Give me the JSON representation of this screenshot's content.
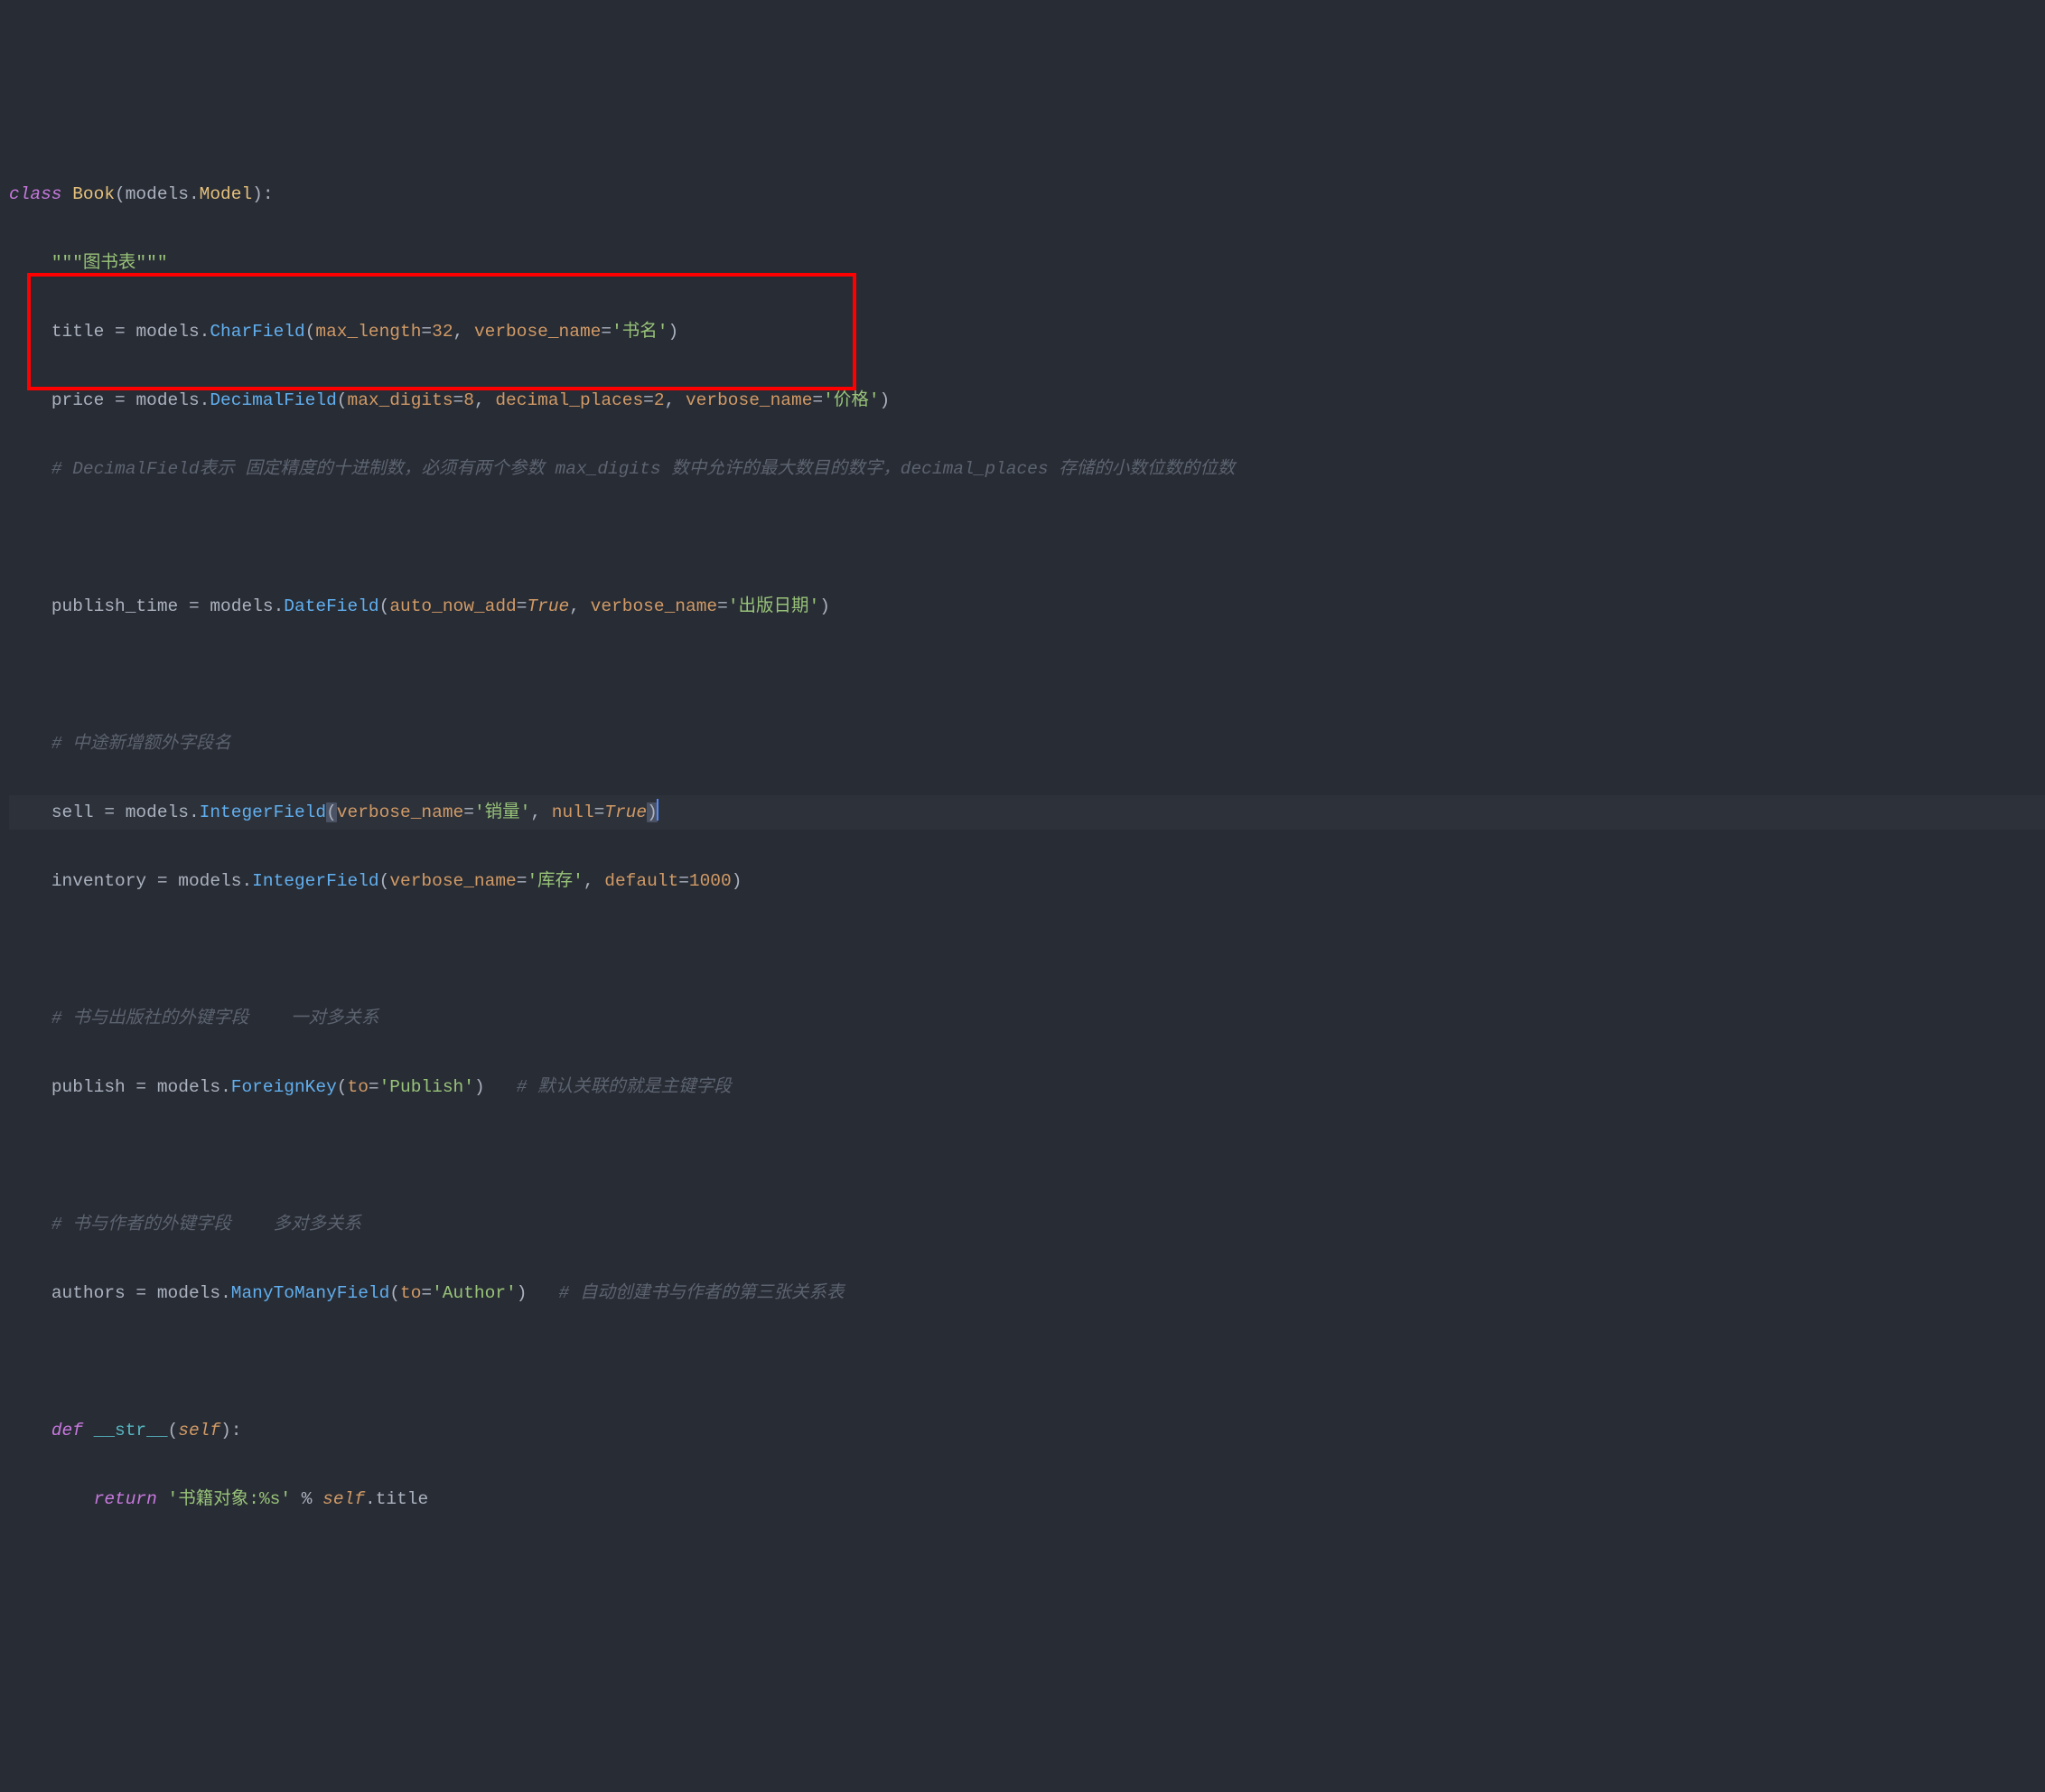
{
  "colors": {
    "background": "#282c34",
    "keyword": "#c678dd",
    "class": "#e5c07b",
    "function": "#61afef",
    "param": "#d19a66",
    "string": "#98c379",
    "comment": "#5c6370",
    "text": "#abb2bf",
    "attr": "#e06c75",
    "dunder": "#56b6c2",
    "highlight_box": "#ff0000",
    "bracket_match_bg": "#4b5263",
    "cursor": "#528bff"
  },
  "code": {
    "line1": {
      "kw_class": "class",
      "sp": " ",
      "name": "Book",
      "lp": "(",
      "base_mod": "models",
      "dot": ".",
      "base_cls": "Model",
      "rp": ")",
      "colon": ":"
    },
    "line2": {
      "indent": "    ",
      "doc": "\"\"\"图书表\"\"\""
    },
    "line3": {
      "indent": "    ",
      "var": "title",
      "eq": " = ",
      "mod": "models",
      "dot": ".",
      "fn": "CharField",
      "lp": "(",
      "p1": "max_length",
      "p1eq": "=",
      "p1v": "32",
      "comma1": ", ",
      "p2": "verbose_name",
      "p2eq": "=",
      "p2v": "'书名'",
      "rp": ")"
    },
    "line4": {
      "indent": "    ",
      "var": "price",
      "eq": " = ",
      "mod": "models",
      "dot": ".",
      "fn": "DecimalField",
      "lp": "(",
      "p1": "max_digits",
      "p1eq": "=",
      "p1v": "8",
      "comma1": ", ",
      "p2": "decimal_places",
      "p2eq": "=",
      "p2v": "2",
      "comma2": ", ",
      "p3": "verbose_name",
      "p3eq": "=",
      "p3v": "'价格'",
      "rp": ")"
    },
    "line5": {
      "indent": "    ",
      "cmt": "# DecimalField表示 固定精度的十进制数，必须有两个参数 max_digits 数中允许的最大数目的数字，decimal_places 存储的小数位数的位数"
    },
    "line6_blank": " ",
    "line7": {
      "indent": "    ",
      "var": "publish_time",
      "eq": " = ",
      "mod": "models",
      "dot": ".",
      "fn": "DateField",
      "lp": "(",
      "p1": "auto_now_add",
      "p1eq": "=",
      "p1v": "True",
      "comma1": ", ",
      "p2": "verbose_name",
      "p2eq": "=",
      "p2v": "'出版日期'",
      "rp": ")"
    },
    "line8_blank": " ",
    "line9": {
      "indent": "    ",
      "cmt": "# 中途新增额外字段名"
    },
    "line10": {
      "indent": "    ",
      "var": "sell",
      "eq": " = ",
      "mod": "models",
      "dot": ".",
      "fn": "IntegerField",
      "lp": "(",
      "p1": "verbose_name",
      "p1eq": "=",
      "p1v": "'销量'",
      "comma1": ", ",
      "p2": "null",
      "p2eq": "=",
      "p2v": "True",
      "rp": ")"
    },
    "line11": {
      "indent": "    ",
      "var": "inventory",
      "eq": " = ",
      "mod": "models",
      "dot": ".",
      "fn": "IntegerField",
      "lp": "(",
      "p1": "verbose_name",
      "p1eq": "=",
      "p1v": "'库存'",
      "comma1": ", ",
      "p2": "default",
      "p2eq": "=",
      "p2v": "1000",
      "rp": ")"
    },
    "line12_blank": " ",
    "line13": {
      "indent": "    ",
      "cmt": "# 书与出版社的外键字段    一对多关系"
    },
    "line14": {
      "indent": "    ",
      "var": "publish",
      "eq": " = ",
      "mod": "models",
      "dot": ".",
      "fn": "ForeignKey",
      "lp": "(",
      "p1": "to",
      "p1eq": "=",
      "p1v": "'Publish'",
      "rp": ")",
      "trail_sp": "   ",
      "trail_cmt": "# 默认关联的就是主键字段"
    },
    "line15_blank": " ",
    "line16": {
      "indent": "    ",
      "cmt": "# 书与作者的外键字段    多对多关系"
    },
    "line17": {
      "indent": "    ",
      "var": "authors",
      "eq": " = ",
      "mod": "models",
      "dot": ".",
      "fn": "ManyToManyField",
      "lp": "(",
      "p1": "to",
      "p1eq": "=",
      "p1v": "'Author'",
      "rp": ")",
      "trail_sp": "   ",
      "trail_cmt": "# 自动创建书与作者的第三张关系表"
    },
    "line18_blank": " ",
    "line19": {
      "indent": "    ",
      "kw_def": "def",
      "sp": " ",
      "name": "__str__",
      "lp": "(",
      "self": "self",
      "rp": ")",
      "colon": ":"
    },
    "line20": {
      "indent": "        ",
      "kw_ret": "return",
      "sp": " ",
      "str": "'书籍对象:%s'",
      "pct": " % ",
      "self": "self",
      "dot": ".",
      "attr": "title"
    }
  }
}
